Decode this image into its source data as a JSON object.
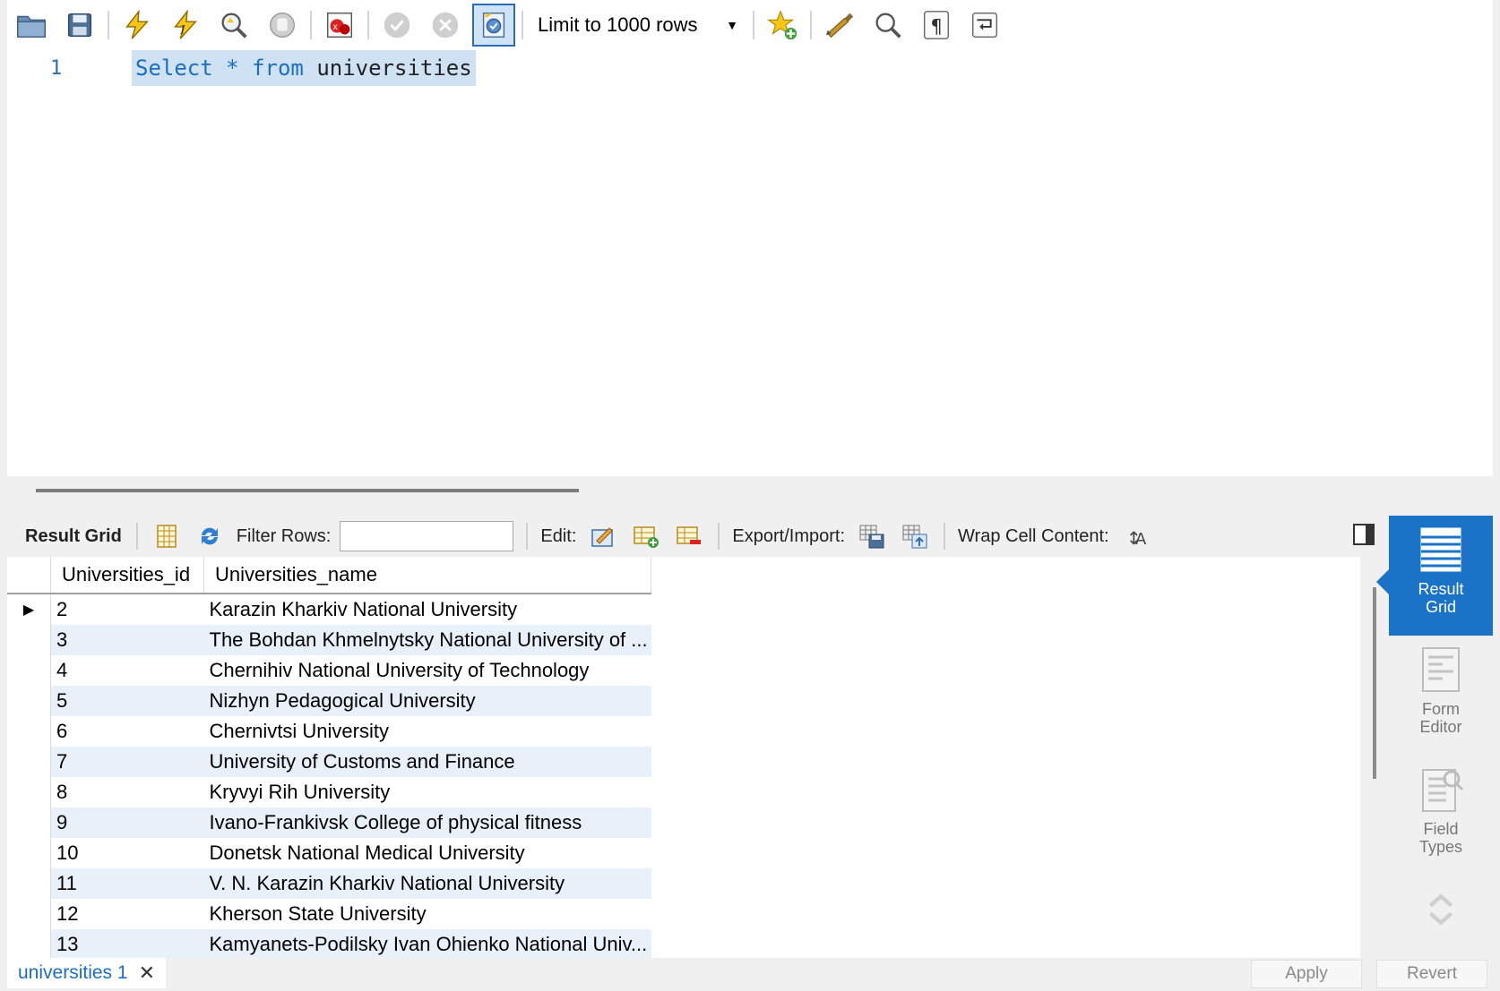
{
  "toolbar": {
    "buttons": [
      "open-file-icon",
      "save-icon",
      "execute-icon",
      "execute-current-icon",
      "explain-icon",
      "stop-icon",
      "toggle-error-icon",
      "commit-icon",
      "rollback-icon",
      "autocommit-icon"
    ],
    "limit_label": "Limit to 1000 rows",
    "right_buttons": [
      "add-snippet-icon",
      "beautify-icon",
      "find-icon",
      "invisible-chars-icon",
      "wrap-lines-icon"
    ]
  },
  "editor": {
    "line_number": "1",
    "keyword_select": "Select",
    "star": "*",
    "keyword_from": "from",
    "table_name": "universities"
  },
  "result_toolbar": {
    "result_grid_label": "Result Grid",
    "filter_label": "Filter Rows:",
    "filter_value": "",
    "edit_label": "Edit:",
    "export_label": "Export/Import:",
    "wrap_label": "Wrap Cell Content:"
  },
  "grid": {
    "columns": [
      "Universities_id",
      "Universities_name"
    ],
    "rows": [
      {
        "id": "2",
        "name": "Karazin Kharkiv National University"
      },
      {
        "id": "3",
        "name": "The Bohdan Khmelnytsky National University of ..."
      },
      {
        "id": "4",
        "name": "Chernihiv National University of Technology"
      },
      {
        "id": "5",
        "name": "Nizhyn Pedagogical University"
      },
      {
        "id": "6",
        "name": "Chernivtsi University"
      },
      {
        "id": "7",
        "name": "University of Customs and Finance"
      },
      {
        "id": "8",
        "name": "Kryvyi Rih University"
      },
      {
        "id": "9",
        "name": "Ivano-Frankivsk College of physical fitness"
      },
      {
        "id": "10",
        "name": "Donetsk National Medical University"
      },
      {
        "id": "11",
        "name": "V. N. Karazin Kharkiv National University"
      },
      {
        "id": "12",
        "name": "Kherson State University"
      },
      {
        "id": "13",
        "name": "Kamyanets-Podilsky Ivan Ohienko National Univ..."
      }
    ]
  },
  "side_panel": {
    "result_grid": "Result Grid",
    "form_editor": "Form Editor",
    "field_types": "Field Types"
  },
  "bottom": {
    "tab_label": "universities 1",
    "apply_label": "Apply",
    "revert_label": "Revert"
  },
  "colors": {
    "accent": "#1a73c6",
    "keyword": "#1a6fc4",
    "selection": "#cfe2f3",
    "row_alt": "#e8f0fa"
  }
}
